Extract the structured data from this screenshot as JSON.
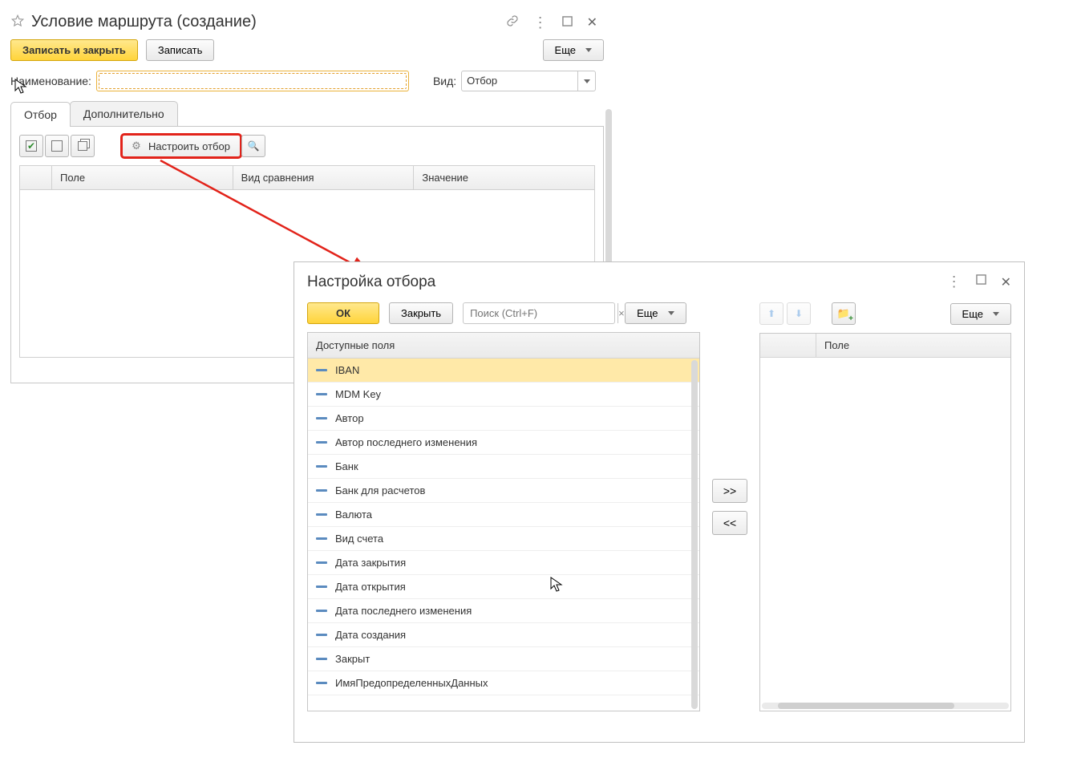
{
  "win1": {
    "title": "Условие маршрута (создание)",
    "saveClose": "Записать и закрыть",
    "save": "Записать",
    "more": "Еще",
    "nameLabel": "Наименование:",
    "nameValue": "",
    "kindLabel": "Вид:",
    "kindValue": "Отбор",
    "tabs": {
      "filter": "Отбор",
      "additional": "Дополнительно"
    },
    "configureFilter": "Настроить отбор",
    "grid": {
      "col_field": "Поле",
      "col_compare": "Вид сравнения",
      "col_value": "Значение"
    }
  },
  "win2": {
    "title": "Настройка отбора",
    "ok": "ОК",
    "close": "Закрыть",
    "searchPlaceholder": "Поиск (Ctrl+F)",
    "more": "Еще",
    "availableHeader": "Доступные поля",
    "fields": [
      "IBAN",
      "MDM Key",
      "Автор",
      "Автор последнего изменения",
      "Банк",
      "Банк для расчетов",
      "Валюта",
      "Вид счета",
      "Дата закрытия",
      "Дата открытия",
      "Дата последнего изменения",
      "Дата создания",
      "Закрыт",
      "ИмяПредопределенныхДанных"
    ],
    "moveRight": ">>",
    "moveLeft": "<<",
    "rightMore": "Еще",
    "rightHeader": {
      "col_field": "Поле"
    }
  }
}
